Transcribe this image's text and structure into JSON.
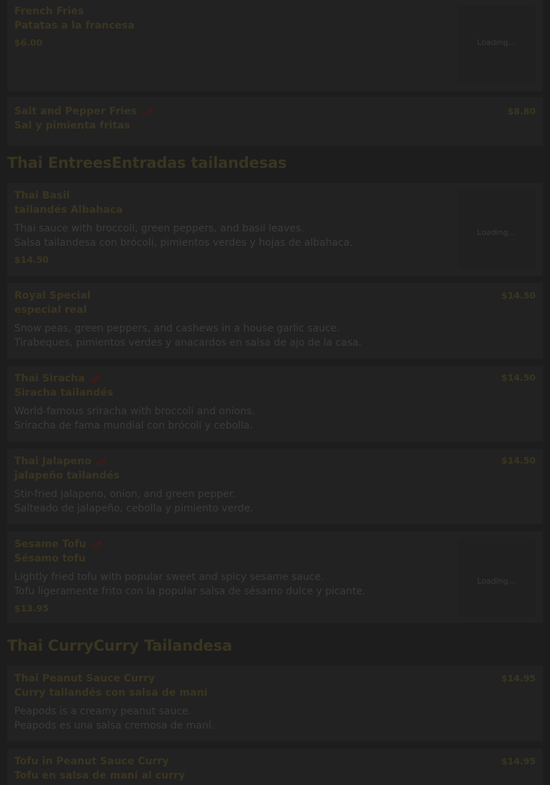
{
  "sections": [
    {
      "title": "Thai EntreesEntradas tailandesas"
    },
    {
      "title": "Thai CurryCurry Tailandesa"
    }
  ],
  "items": [
    {
      "name": "French Fries",
      "name_es": "Patatas a la francesa",
      "price": "$6.00",
      "loading": "Loading..."
    },
    {
      "name": "Salt and Pepper Fries",
      "name_es": "Sal y pimienta fritas",
      "price": "$8.80",
      "spicy_icon": "chili-icon"
    },
    {
      "name": "Thai Basil",
      "name_es": "tailandés Albahaca",
      "desc": "Thai sauce with broccoli, green peppers, and basil leaves.",
      "desc_es": "Salsa tailandesa con brócoli, pimientos verdes y hojas de albahaca.",
      "price": "$14.50",
      "loading": "Loading..."
    },
    {
      "name": "Royal Special",
      "name_es": "especial real",
      "desc": "Snow peas, green peppers, and cashews in a house garlic sauce.",
      "desc_es": "Tirabeques, pimientos verdes y anacardos en salsa de ajo de la casa.",
      "price": "$14.50"
    },
    {
      "name": "Thai Siracha",
      "name_es": "Siracha tailandés",
      "desc": "World-famous sriracha with broccoli and onions.",
      "desc_es": "Sriracha de fama mundial con brócoli y cebolla.",
      "price": "$14.50",
      "spicy_icon": "chili-icon"
    },
    {
      "name": "Thai Jalapeno",
      "name_es": "jalapeño tailandés",
      "desc": "Stir-fried jalapeno, onion, and green pepper.",
      "desc_es": "Salteado de jalapeño, cebolla y pimiento verde.",
      "price": "$14.50",
      "spicy_icon": "chili-icon"
    },
    {
      "name": "Sesame Tofu",
      "name_es": "Sésamo tofu",
      "desc": "Lightly fried tofu with popular sweet and spicy sesame sauce.",
      "desc_es": "Tofu ligeramente frito con la popular salsa de sésamo dulce y picante.",
      "price": "$13.95",
      "loading": "Loading...",
      "spicy_icon": "chili-icon"
    },
    {
      "name": "Thai Peanut Sauce Curry",
      "name_es": "Curry tailandés con salsa de maní",
      "desc": "Peapods is a creamy peanut sauce.",
      "desc_es": "Peapods es una salsa cremosa de maní.",
      "price": "$14.95"
    },
    {
      "name": "Tofu in Peanut Sauce Curry",
      "name_es": "Tofu en salsa de maní al curry",
      "price": "$14.95"
    }
  ],
  "chili_glyph": "🌶",
  "colors": {
    "overlay": "#1d1d1d",
    "card": "#222222",
    "spicy": "#4a1a12"
  }
}
